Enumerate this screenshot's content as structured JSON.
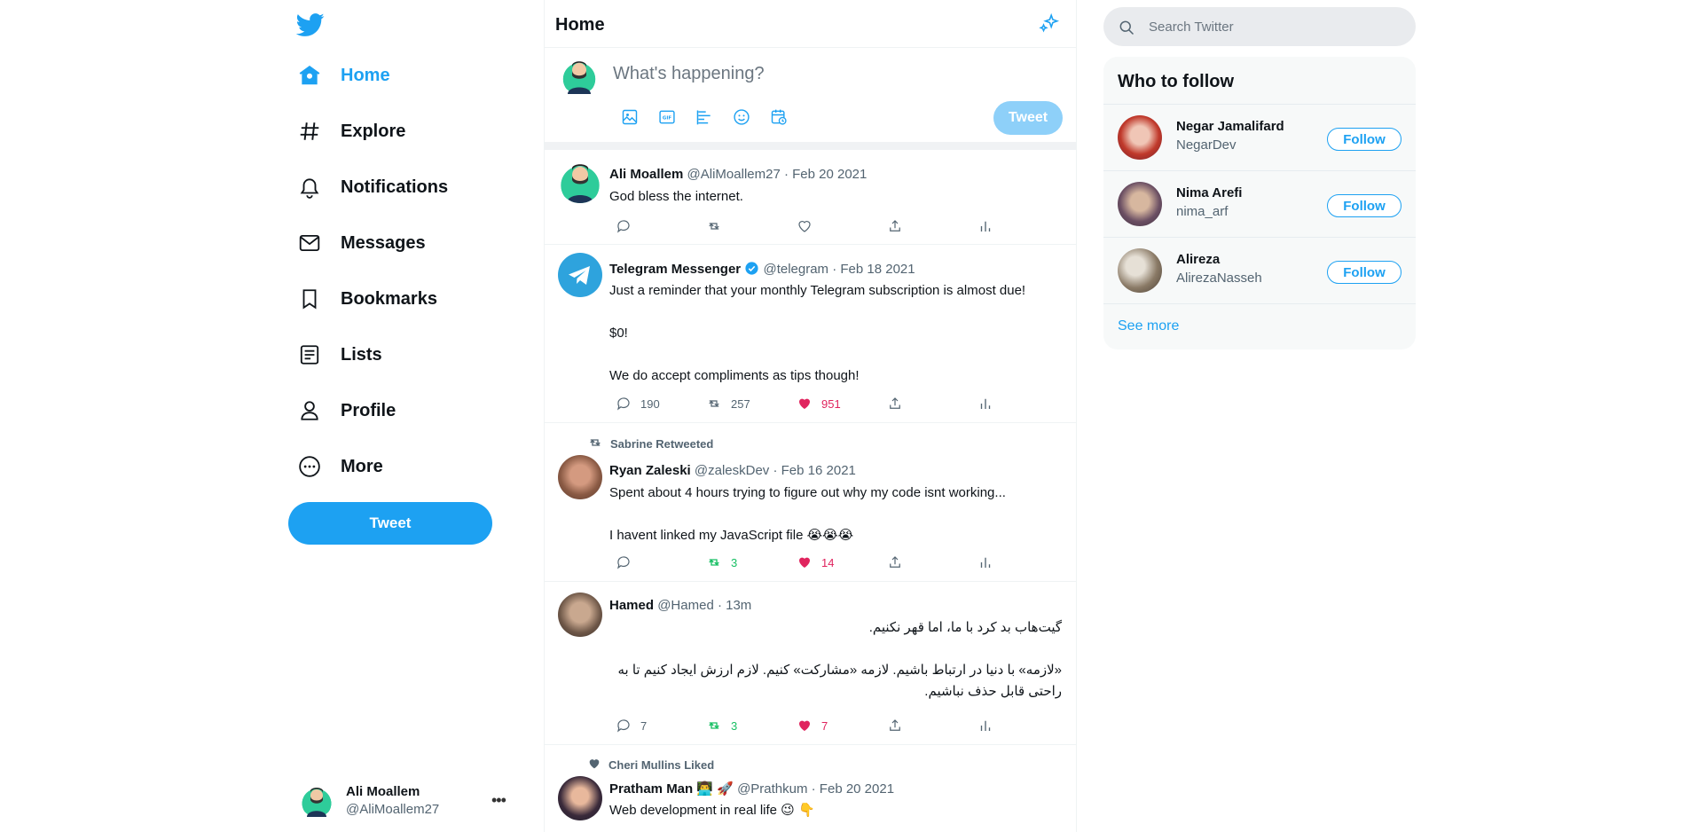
{
  "colors": {
    "accent": "#1da1f2",
    "retweet": "#17bf63",
    "like": "#e0245e"
  },
  "sidebar": {
    "logo_icon": "twitter-bird-icon",
    "items": [
      {
        "label": "Home",
        "icon": "home-icon",
        "active": true
      },
      {
        "label": "Explore",
        "icon": "hashtag-icon"
      },
      {
        "label": "Notifications",
        "icon": "bell-icon"
      },
      {
        "label": "Messages",
        "icon": "envelope-icon"
      },
      {
        "label": "Bookmarks",
        "icon": "bookmark-icon"
      },
      {
        "label": "Lists",
        "icon": "list-icon"
      },
      {
        "label": "Profile",
        "icon": "person-icon"
      },
      {
        "label": "More",
        "icon": "more-circle-icon"
      }
    ],
    "tweet_button": "Tweet",
    "account": {
      "name": "Ali Moallem",
      "handle": "@AliMoallem27"
    }
  },
  "header": {
    "title": "Home"
  },
  "compose": {
    "placeholder": "What's happening?",
    "tools": [
      "image-icon",
      "gif-icon",
      "poll-icon",
      "emoji-icon",
      "schedule-icon"
    ],
    "tweet_button": "Tweet"
  },
  "tweets": [
    {
      "name": "Ali Moallem",
      "handle": "@AliMoallem27 · Feb 20 2021",
      "lines": [
        "God bless the internet."
      ],
      "replies": "",
      "retweets": "",
      "likes": ""
    },
    {
      "name": "Telegram Messenger",
      "verified": true,
      "handle": "@telegram · Feb 18 2021",
      "lines": [
        "Just a reminder that your monthly Telegram subscription is almost due!",
        "$0!",
        "We do accept compliments as tips though!"
      ],
      "replies": "190",
      "retweets": "257",
      "likes": "951"
    },
    {
      "context": "Sabrine Retweeted",
      "name": "Ryan Zaleski",
      "handle": "@zaleskDev · Feb 16 2021",
      "lines": [
        "Spent about 4 hours trying to figure out why my code isnt working...",
        "I havent linked my JavaScript file 😭😭😭"
      ],
      "replies": "",
      "retweets": "3",
      "likes": "14"
    },
    {
      "name": "Hamed",
      "handle": "@Hamed · 13m",
      "lines": [
        "گیت‌هاب بد کرد با ما، اما قهر نکنیم.",
        "«لازمه» با دنیا در ارتباط باشیم. لازمه «مشارکت» کنیم. لازم ارزش ایجاد کنیم تا به راحتی قابل حذف نباشیم."
      ],
      "replies": "7",
      "retweets": "3",
      "likes": "7"
    },
    {
      "context": "Cheri Mullins Liked",
      "name": "Pratham Man 👨‍💻 🚀",
      "handle": "@Prathkum · Feb 20 2021",
      "lines": [
        "Web development in real life 😉 👇"
      ]
    }
  ],
  "right": {
    "search_placeholder": "Search Twitter",
    "who_to_follow": {
      "title": "Who to follow",
      "users": [
        {
          "name": "Negar Jamalifard",
          "handle": "NegarDev",
          "button": "Follow"
        },
        {
          "name": "Nima Arefi",
          "handle": "nima_arf",
          "button": "Follow"
        },
        {
          "name": "Alireza",
          "handle": "AlirezaNasseh",
          "button": "Follow"
        }
      ],
      "see_more": "See more"
    }
  }
}
